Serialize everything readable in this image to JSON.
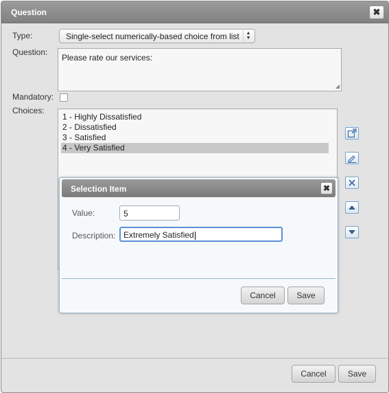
{
  "question_dialog": {
    "title": "Question",
    "type_label": "Type:",
    "type_value": "Single-select numerically-based choice from list",
    "question_label": "Question:",
    "question_value": "Please rate our services:",
    "mandatory_label": "Mandatory:",
    "mandatory_checked": false,
    "choices_label": "Choices:",
    "choices": [
      {
        "label": "1 - Highly Dissatisfied",
        "selected": false
      },
      {
        "label": "2 - Dissatisfied",
        "selected": false
      },
      {
        "label": "3 - Satisfied",
        "selected": false
      },
      {
        "label": "4 - Very Satisfied",
        "selected": true
      }
    ],
    "side_buttons": [
      "add-icon",
      "edit-icon",
      "delete-icon",
      "move-up-icon",
      "move-down-icon"
    ],
    "cancel_label": "Cancel",
    "save_label": "Save"
  },
  "selection_item_dialog": {
    "title": "Selection Item",
    "value_label": "Value:",
    "value": "5",
    "description_label": "Description:",
    "description": "Extremely Satisfied",
    "cancel_label": "Cancel",
    "save_label": "Save"
  },
  "colors": {
    "title_bar": "#8a8a8a",
    "selection": "#c8c8c8",
    "focus_border": "#5a8fd6",
    "icon_blue": "#3a6ea5"
  }
}
